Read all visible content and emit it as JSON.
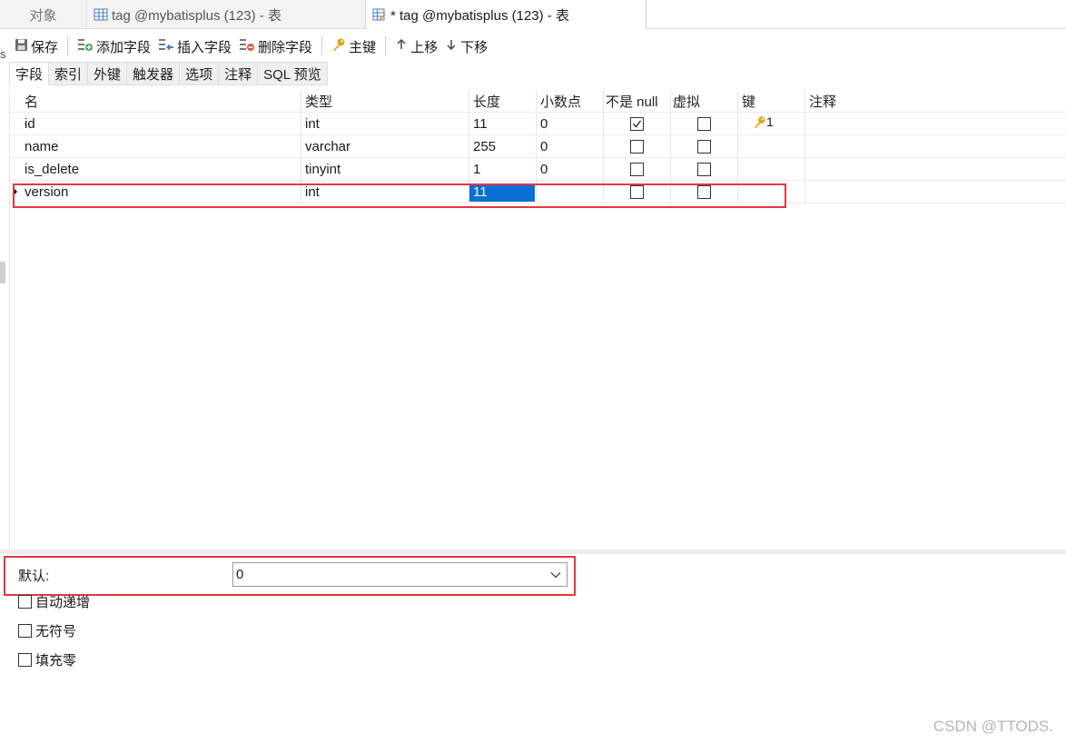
{
  "tabs": {
    "objects": "对象",
    "tab1": "tag @mybatisplus (123) - 表",
    "tab2": "* tag @mybatisplus (123) - 表"
  },
  "side_char": "s",
  "toolbar": {
    "save": "保存",
    "add_field": "添加字段",
    "insert_field": "插入字段",
    "delete_field": "删除字段",
    "primary_key": "主键",
    "move_up": "上移",
    "move_down": "下移"
  },
  "subtabs": [
    "字段",
    "索引",
    "外键",
    "触发器",
    "选项",
    "注释",
    "SQL 预览"
  ],
  "grid": {
    "headers": [
      "名",
      "类型",
      "长度",
      "小数点",
      "不是 null",
      "虚拟",
      "键",
      "注释"
    ],
    "rows": [
      {
        "name": "id",
        "type": "int",
        "length": "11",
        "decimals": "0",
        "not_null": true,
        "virtual": false,
        "key": "1",
        "comment": ""
      },
      {
        "name": "name",
        "type": "varchar",
        "length": "255",
        "decimals": "0",
        "not_null": false,
        "virtual": false,
        "key": "",
        "comment": ""
      },
      {
        "name": "is_delete",
        "type": "tinyint",
        "length": "1",
        "decimals": "0",
        "not_null": false,
        "virtual": false,
        "key": "",
        "comment": ""
      },
      {
        "name": "version",
        "type": "int",
        "length": "11",
        "decimals": "",
        "not_null": false,
        "virtual": false,
        "key": "",
        "comment": ""
      }
    ]
  },
  "properties": {
    "default_label": "默认:",
    "default_value": "0",
    "auto_increment": "自动递增",
    "unsigned": "无符号",
    "zerofill": "填充零"
  },
  "watermark": "CSDN @TTODS.",
  "colors": {
    "highlight_border": "#e0393e",
    "selection": "#0a6fd4",
    "key_icon": "#e2a31b"
  }
}
